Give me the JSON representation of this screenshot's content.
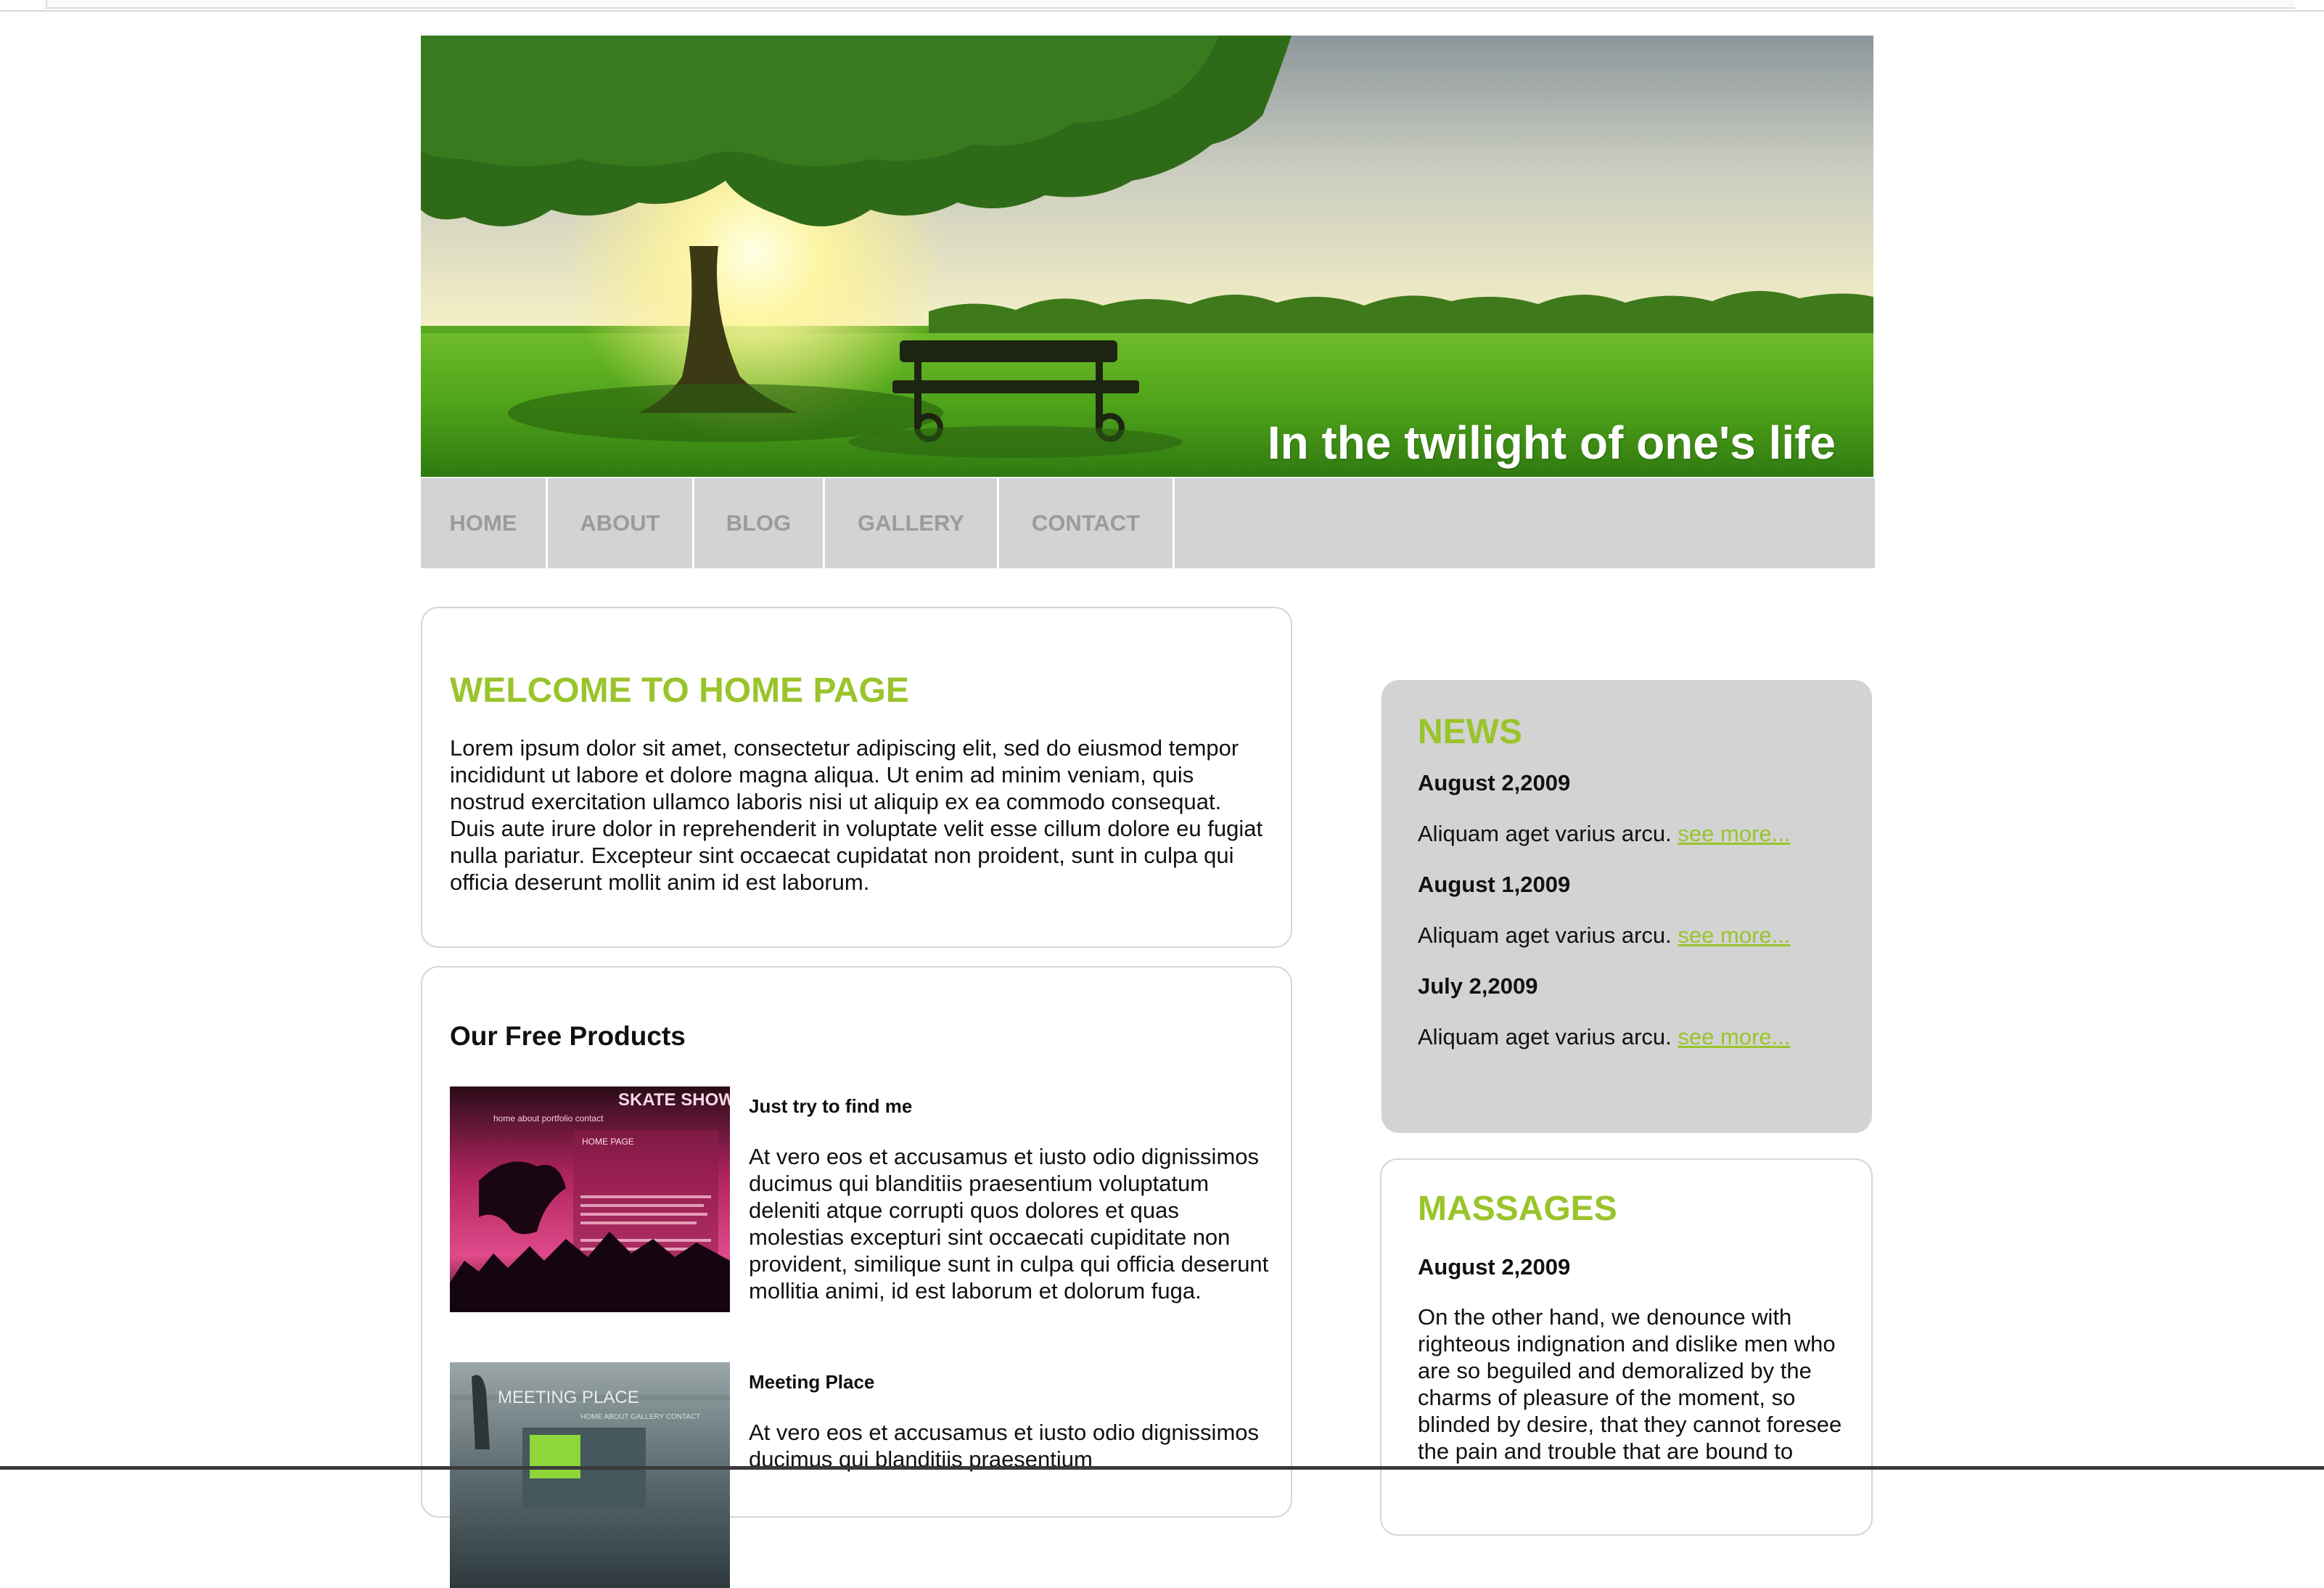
{
  "banner": {
    "tagline": "In the twilight of one's life"
  },
  "nav": {
    "items": [
      "HOME",
      "ABOUT",
      "BLOG",
      "GALLERY",
      "CONTACT"
    ]
  },
  "welcome": {
    "title": "WELCOME TO HOME PAGE",
    "body": "Lorem ipsum dolor sit amet, consectetur adipiscing elit, sed do eiusmod tempor incididunt ut labore et dolore magna aliqua. Ut enim ad minim veniam, quis nostrud exercitation ullamco laboris nisi ut aliquip ex ea commodo consequat. Duis aute irure dolor in reprehenderit in voluptate velit esse cillum dolore eu fugiat nulla pariatur. Excepteur sint occaecat cupidatat non proident, sunt in culpa qui officia deserunt mollit anim id est laborum."
  },
  "products": {
    "title": "Our Free Products",
    "items": [
      {
        "title": "Just try to find me",
        "description": "At vero eos et accusamus et iusto odio dignissimos ducimus qui blanditiis praesentium voluptatum deleniti atque corrupti quos dolores et quas molestias excepturi sint occaecati cupiditate non provident, similique sunt in culpa qui officia deserunt mollitia animi, id est laborum et dolorum fuga.",
        "thumb_text": {
          "brand": "SKATE SHOW",
          "nav": "home   about   portfolio   contact",
          "label": "HOME PAGE"
        }
      },
      {
        "title": "Meeting Place",
        "description": "At vero eos et accusamus et iusto odio dignissimos ducimus qui blanditiis praesentium",
        "thumb_text": {
          "brand": "MEETING PLACE",
          "nav": "HOME   ABOUT   GALLERY   CONTACT"
        }
      }
    ]
  },
  "news": {
    "title": "NEWS",
    "items": [
      {
        "date": "August 2,2009",
        "text": "Aliquam aget varius arcu.",
        "link": "see more..."
      },
      {
        "date": "August 1,2009",
        "text": "Aliquam aget varius arcu.",
        "link": "see more..."
      },
      {
        "date": "July 2,2009",
        "text": "Aliquam aget varius arcu.",
        "link": "see more..."
      }
    ]
  },
  "massages": {
    "title": "MASSAGES",
    "date": "August 2,2009",
    "text": "On the other hand, we denounce with righteous indignation and dislike men who are so beguiled and demoralized by the charms of pleasure of the moment, so blinded by desire, that they cannot foresee the pain and trouble that are bound to"
  },
  "colors": {
    "accent": "#9ac42b",
    "nav_bg": "#d3d3d3",
    "nav_text": "#9b9b9b"
  }
}
